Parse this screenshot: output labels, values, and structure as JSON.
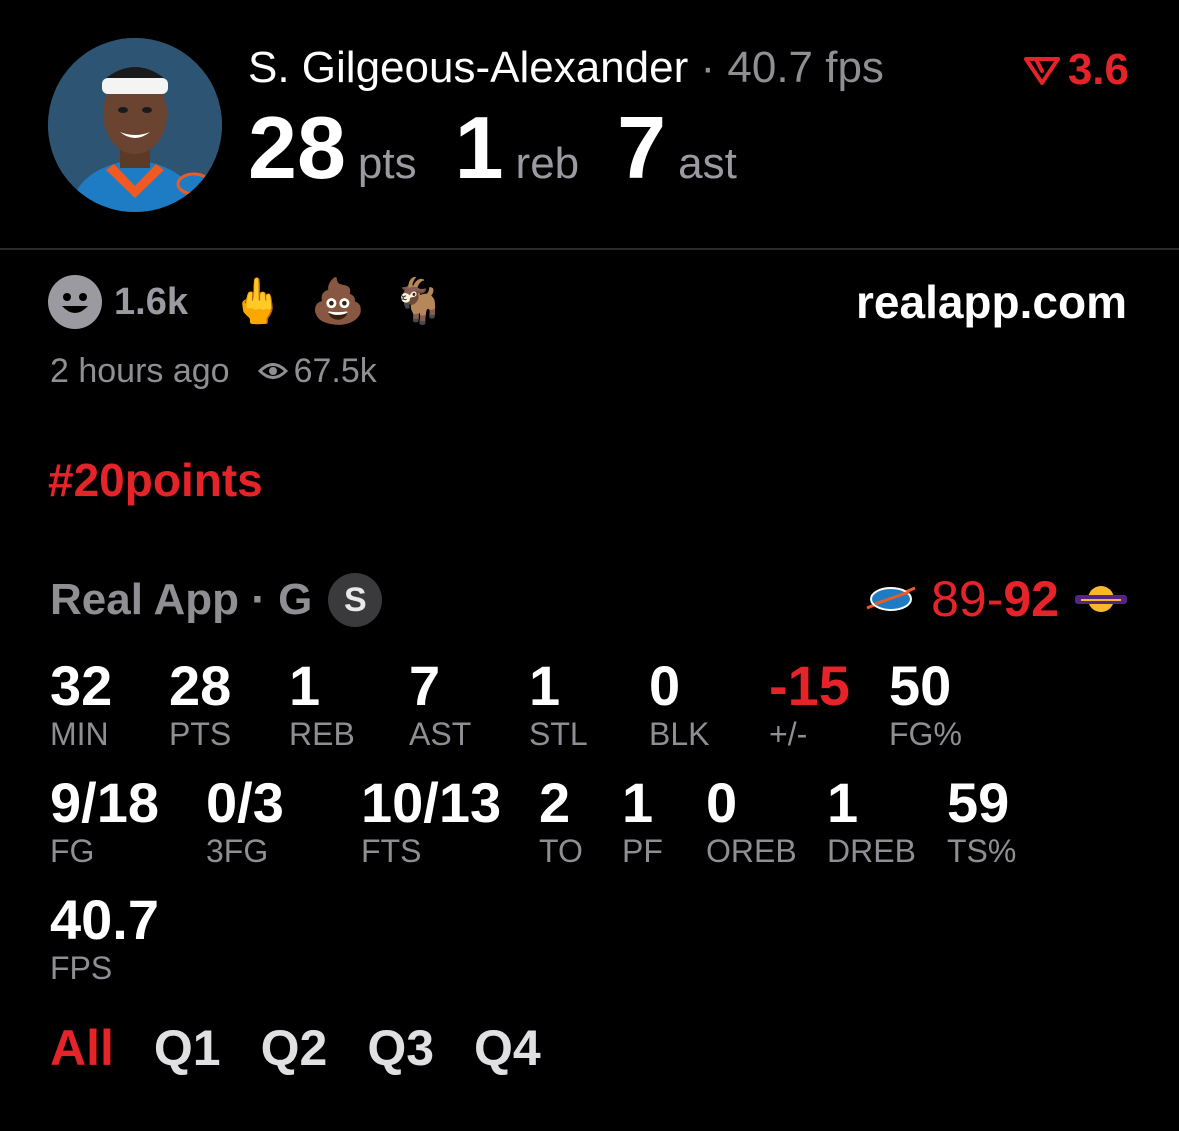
{
  "header": {
    "player_name": "S. Gilgeous-Alexander",
    "separator": "·",
    "fps_text": "40.7 fps",
    "trend_value": "3.6",
    "trend_direction": "down",
    "stats": [
      {
        "value": "28",
        "unit": "pts"
      },
      {
        "value": "1",
        "unit": "reb"
      },
      {
        "value": "7",
        "unit": "ast"
      }
    ]
  },
  "reactions": {
    "count": "1.6k",
    "emojis": [
      "🖕",
      "💩",
      "🐐"
    ],
    "site": "realapp.com"
  },
  "meta": {
    "time_ago": "2 hours ago",
    "views": "67.5k"
  },
  "hashtag": "#20points",
  "game": {
    "source_label": "Real App · G",
    "badge": "S",
    "score_home": "89",
    "score_dash": "-",
    "score_away": "92",
    "team_left": "OKC",
    "team_right": "LAKERS"
  },
  "stats_grid": [
    {
      "value": "32",
      "label": "MIN"
    },
    {
      "value": "28",
      "label": "PTS"
    },
    {
      "value": "1",
      "label": "REB"
    },
    {
      "value": "7",
      "label": "AST"
    },
    {
      "value": "1",
      "label": "STL"
    },
    {
      "value": "0",
      "label": "BLK"
    },
    {
      "value": "-15",
      "label": "+/-"
    },
    {
      "value": "50",
      "label": "FG%"
    },
    {
      "value": "9/18",
      "label": "FG"
    },
    {
      "value": "0/3",
      "label": "3FG"
    },
    {
      "value": "10/13",
      "label": "FTS"
    },
    {
      "value": "2",
      "label": "TO"
    },
    {
      "value": "1",
      "label": "PF"
    },
    {
      "value": "0",
      "label": "OREB"
    },
    {
      "value": "1",
      "label": "DREB"
    },
    {
      "value": "59",
      "label": "TS%"
    },
    {
      "value": "40.7",
      "label": "FPS"
    }
  ],
  "tabs": [
    "All",
    "Q1",
    "Q2",
    "Q3",
    "Q4"
  ],
  "active_tab": "All",
  "colors": {
    "accent_red": "#e5242a",
    "muted_gray": "#8e8e93",
    "background": "#000000"
  }
}
